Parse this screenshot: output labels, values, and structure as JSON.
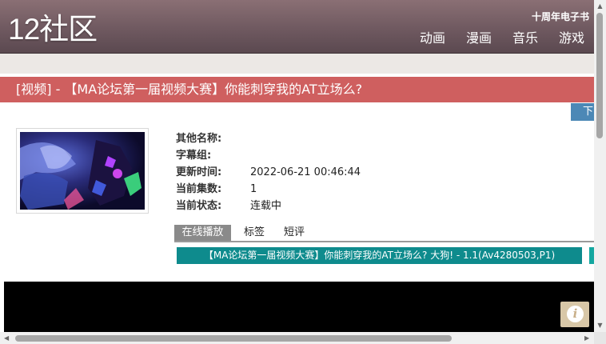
{
  "header": {
    "logo": "12社区",
    "ebook_link": "十周年电子书",
    "nav": [
      "动画",
      "漫画",
      "音乐",
      "游戏"
    ]
  },
  "title_bar": {
    "title": "[视频] - 【MA论坛第一届视频大赛】你能刺穿我的AT立场么?"
  },
  "download_tab": {
    "label": "下载"
  },
  "info": {
    "rows": [
      {
        "key": "其他名称:",
        "value": ""
      },
      {
        "key": "字幕组:",
        "value": ""
      },
      {
        "key": "更新时间:",
        "value": "2022-06-21 00:46:44"
      },
      {
        "key": "当前集数:",
        "value": "1"
      },
      {
        "key": "当前状态:",
        "value": "连载中"
      }
    ]
  },
  "tabs": {
    "online": "在线播放",
    "tags": "标签",
    "reviews": "短评"
  },
  "episode": {
    "label": "【MA论坛第一届视频大赛】你能刺穿我的AT立场么? 大狗! - 1.1(Av4280503,P1)"
  },
  "player": {
    "info_icon": "info-icon"
  },
  "colors": {
    "header": "#6f5960",
    "title_bar": "#cf5f5f",
    "download_tab": "#4c88b6",
    "episode": "#0e8b8d",
    "active_tab": "#8a8a8a"
  }
}
